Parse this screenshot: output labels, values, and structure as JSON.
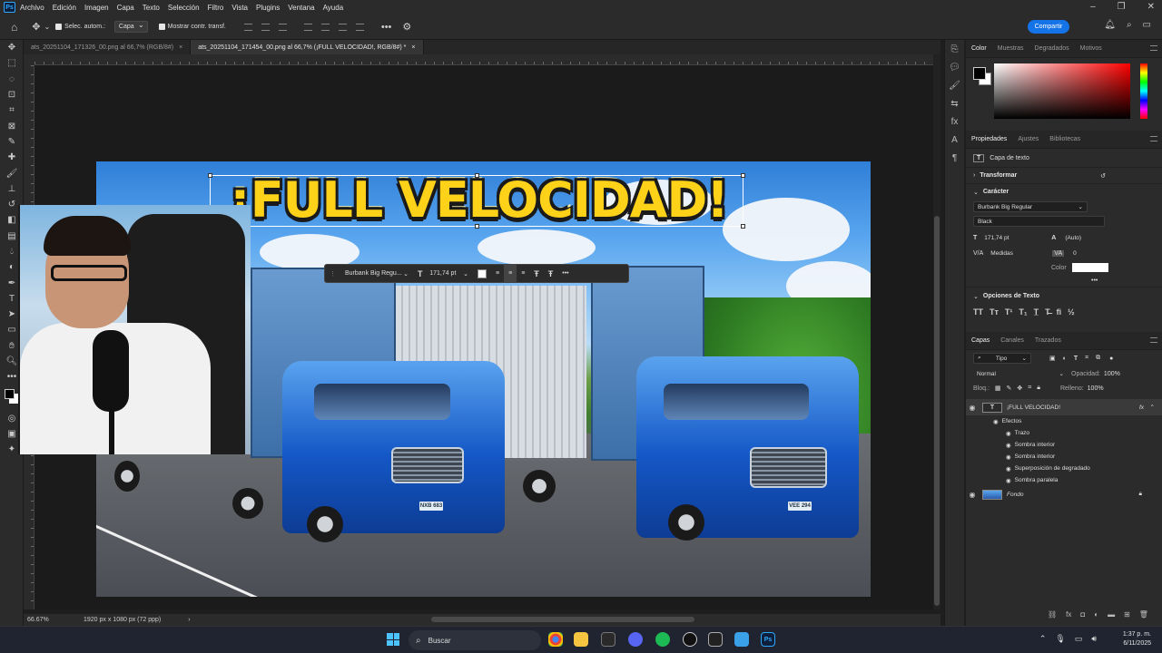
{
  "menu": {
    "items": [
      "Archivo",
      "Edición",
      "Imagen",
      "Capa",
      "Texto",
      "Selección",
      "Filtro",
      "Vista",
      "Plugins",
      "Ventana",
      "Ayuda"
    ]
  },
  "options_bar": {
    "auto_select_label": "Selec. autom.:",
    "auto_select_value": "Capa",
    "show_transform_label": "Mostrar contr. transf.",
    "share_label": "Compartir"
  },
  "tabs": [
    {
      "label": "ats_20251104_171326_00.png al 66,7% (RGB/8#)",
      "close": "×",
      "active": false
    },
    {
      "label": "ats_20251104_171454_00.png al 66,7% (¡FULL VELOCIDAD!, RGB/8#) *",
      "close": "×",
      "active": true
    }
  ],
  "canvas": {
    "headline": "¡FULL VELOCIDAD!",
    "plate_left": "NXB 683",
    "plate_right": "VEE 294"
  },
  "float_bar": {
    "font": "Burbank Big Regu...",
    "size": "171,74 pt"
  },
  "panels": {
    "color_tabs": [
      "Color",
      "Muestras",
      "Degradados",
      "Motivos"
    ],
    "props_tabs": [
      "Propiedades",
      "Ajustes",
      "Bibliotecas"
    ],
    "layer_type": "Capa de texto",
    "transform": "Transformar",
    "character": "Carácter",
    "font_family": "Burbank Big Regular",
    "font_style": "Black",
    "font_size": "171,74 pt",
    "leading": "(Auto)",
    "kerning": "Medidas",
    "tracking": "0",
    "color_label": "Color",
    "text_options": "Opciones de Texto",
    "layers_tabs": [
      "Capas",
      "Canales",
      "Trazados"
    ],
    "filter_kind": "Tipo",
    "blend_mode": "Normal",
    "opacity_label": "Opacidad:",
    "opacity": "100%",
    "lock_label": "Bloq.:",
    "fill_label": "Relleno:",
    "fill": "100%",
    "layers": [
      {
        "name": "¡FULL VELOCIDAD!",
        "type": "text"
      },
      {
        "name": "Efectos",
        "type": "effects"
      },
      {
        "name": "Trazo",
        "type": "effect"
      },
      {
        "name": "Sombra interior",
        "type": "effect"
      },
      {
        "name": "Sombra interior",
        "type": "effect"
      },
      {
        "name": "Superposición de degradado",
        "type": "effect"
      },
      {
        "name": "Sombra paralela",
        "type": "effect"
      },
      {
        "name": "Fondo",
        "type": "image"
      }
    ]
  },
  "status": {
    "zoom": "66.67%",
    "doc_size": "1920 px x 1080 px (72 ppp)"
  },
  "taskbar": {
    "search": "Buscar",
    "time": "1:37 p. m.",
    "date": "6/11/2025"
  },
  "colors": {
    "accent": "#1473e6",
    "headline": "#ffd21a"
  }
}
